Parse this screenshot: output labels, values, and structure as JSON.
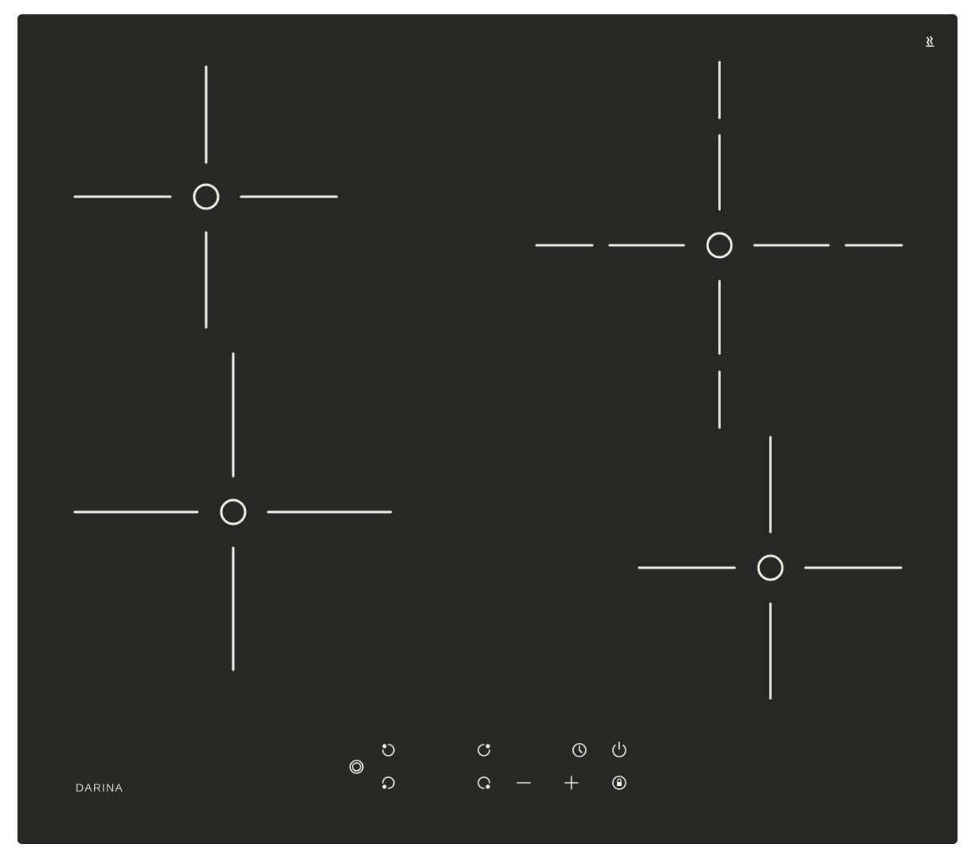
{
  "brand": {
    "name": "DARINA"
  },
  "hob": {
    "zones": [
      {
        "id": "front-left",
        "position": "top-left",
        "guide_style": "solid"
      },
      {
        "id": "rear-left",
        "position": "bottom-left",
        "guide_style": "solid"
      },
      {
        "id": "top-right",
        "position": "top-right",
        "guide_style": "segmented"
      },
      {
        "id": "bottom-right",
        "position": "bottom-right",
        "guide_style": "solid"
      }
    ],
    "colors": {
      "surface": "#272725",
      "markings": "#efefea",
      "background": "#ffffff"
    }
  },
  "controls": {
    "zone_select": {
      "icon": "zone-select-icon"
    },
    "zone_top_left": {
      "icon": "zone-top-left-icon"
    },
    "zone_bottom_left": {
      "icon": "zone-bottom-left-icon"
    },
    "zone_top_right": {
      "icon": "zone-top-right-icon"
    },
    "zone_bottom_right": {
      "icon": "zone-bottom-right-icon"
    },
    "minus": {
      "icon": "minus-icon"
    },
    "plus": {
      "icon": "plus-icon"
    },
    "timer": {
      "icon": "timer-icon"
    },
    "power": {
      "icon": "power-icon"
    },
    "lock": {
      "icon": "lock-icon"
    },
    "hot_surface": {
      "icon": "hot-surface-icon"
    }
  }
}
